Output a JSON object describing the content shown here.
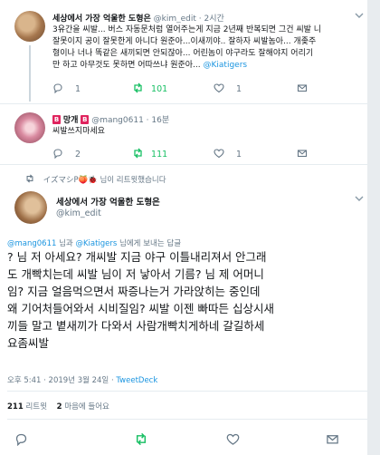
{
  "tweet1": {
    "name": "세상에서 가장 억울한 도형은",
    "handle": "@kim_edit",
    "dot": "·",
    "time": "2시간",
    "lines": [
      "3유간을 씨발... 버스 자동문처럼 열어주는게 지금 2년째 반복되면 그건 씨발 니",
      "잘못이지 공이 잘못한게 아니다 원준아...이새끼야.. 잘하자 씨발놈아... 개좆주",
      "형이나 너나 똑같은 새끼되면 안되잖아... 어린놈이 야구라도 잘해야지 어리기"
    ],
    "last_line": "만 하고 아무것도 못하면 어따쓰냐 원준아... ",
    "mention": "@Kiatigers",
    "replies": "1",
    "retweets": "101",
    "likes": "1"
  },
  "tweet2": {
    "badge_left": "B",
    "name_core": "망개",
    "badge_right": "B",
    "handle": "@mang0611",
    "dot": "·",
    "time": "16분",
    "text": "씨발쓰지마세요",
    "replies": "2",
    "retweets": "111",
    "likes": "1"
  },
  "retweet_note": "イズマシP🍑🐞 님이 리트윗했습니다",
  "tweet3": {
    "name": "세상에서 가장 억울한 도형은",
    "handle": "@kim_edit",
    "reply_mention1": "@mang0611",
    "reply_and": " 님과 ",
    "reply_mention2": "@Kiatigers",
    "reply_suffix": " 님에게 보내는 답글",
    "lines": [
      "? 님 저 아세요? 개씨발 지금 야구 이틀내리져서 안그래",
      "도 개빡치는데 씨발 님이 저 낳아서 기름? 님 제 어머니",
      "임? 지금 얼음먹으면서 짜증나는거 가라앉히는 중인데",
      "왜 기어처들어와서 시비질임? 씨발 이젠 빠따든 십상시새",
      "끼들 말고 볕새끼가 다와서 사람개빡치게하네 갈길하세",
      "요좀씨발"
    ],
    "timestamp": "오후 5:41 · 2019년 3월 24일 · ",
    "source": "TweetDeck",
    "retweet_count": "211",
    "retweet_label": " 리트윗",
    "like_count": "2",
    "like_label": " 마음에 들어요"
  }
}
